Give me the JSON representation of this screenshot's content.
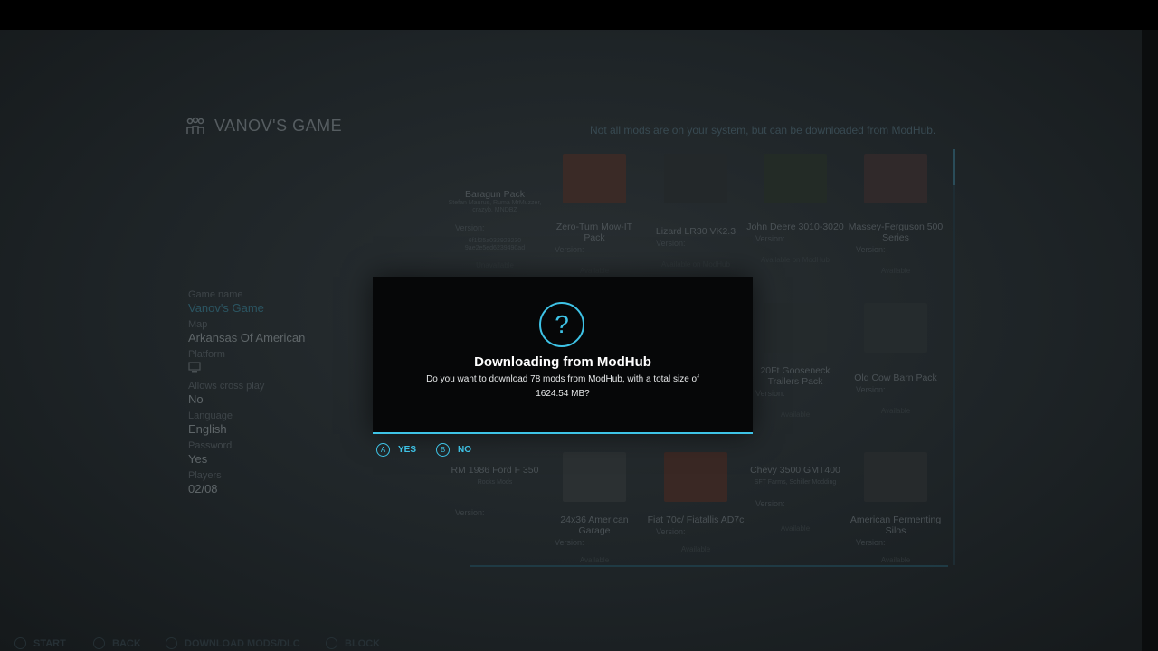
{
  "header": {
    "title": "VANOV'S GAME",
    "icon": "players-icon"
  },
  "notice": "Not all mods are on your system, but can be downloaded from ModHub.",
  "game_info": [
    {
      "label": "Game name",
      "value": "Vanov's Game",
      "accent": true
    },
    {
      "label": "Map",
      "value": "Arkansas Of American"
    },
    {
      "label": "Platform",
      "value": ""
    },
    {
      "label": "Allows cross play",
      "value": "No"
    },
    {
      "label": "Language",
      "value": "English"
    },
    {
      "label": "Password",
      "value": "Yes"
    },
    {
      "label": "Players",
      "value": "02/08"
    }
  ],
  "mods": [
    {
      "name": "Baragun Pack",
      "sub": "Stefan Maurus, Ruma MrMuzzer, crazyb, MNDBZ",
      "version": "Version:",
      "hash": "6f1f25a032929230 9ae2e5ed6239490ad",
      "status": "Unavailable"
    },
    {
      "name": "Zero-Turn Mow-IT Pack",
      "version": "Version:",
      "status": "Available"
    },
    {
      "name": "Lizard LR30 VK2.3",
      "version": "Version:",
      "status": "Available on ModHub"
    },
    {
      "name": "John Deere 3010-3020",
      "version": "Version:",
      "status": "Available on ModHub"
    },
    {
      "name": "Massey-Ferguson 500 Series",
      "version": "Version:",
      "status": "Available"
    },
    {
      "name": "20Ft Gooseneck Trailers Pack",
      "version": "Version:",
      "status": "Available"
    },
    {
      "name": "Old Cow Barn Pack",
      "version": "Version:",
      "status": "Available"
    },
    {
      "name": "RM 1986 Ford F 350",
      "sub": "Rocks Mods",
      "version": "Version:",
      "status": ""
    },
    {
      "name": "24x36 American Garage",
      "version": "Version:",
      "status": "Available"
    },
    {
      "name": "Fiat 70c/ Fiatallis AD7c",
      "version": "Version:",
      "status": "Available"
    },
    {
      "name": "Chevy 3500 GMT400",
      "sub": "SFT Farms, Schiller Modding",
      "version": "Version:",
      "status": "Available"
    },
    {
      "name": "American Fermenting Silos",
      "version": "Version:",
      "status": "Available"
    }
  ],
  "dialog": {
    "title": "Downloading from ModHub",
    "body": "Do you want to download 78 mods from ModHub, with a total size of 1624.54 MB?",
    "icon": "question-icon"
  },
  "actions": [
    {
      "glyph": "A",
      "label": "YES"
    },
    {
      "glyph": "B",
      "label": "NO"
    }
  ],
  "footer": [
    {
      "label": "START"
    },
    {
      "label": "BACK"
    },
    {
      "label": "DOWNLOAD MODS/DLC"
    },
    {
      "label": "BLOCK"
    }
  ],
  "colors": {
    "accent": "#3ec3e6",
    "dialog_bg": "#060708",
    "backdrop": "#1e2427"
  }
}
